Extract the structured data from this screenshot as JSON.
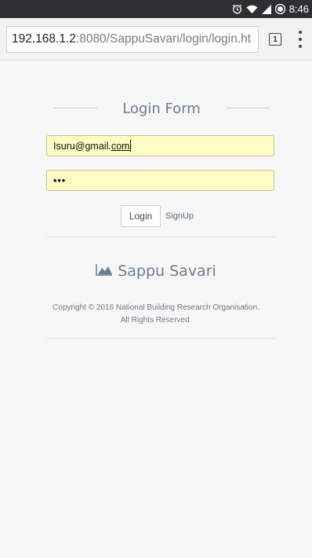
{
  "status_bar": {
    "time": "8:46",
    "alarm_icon": "alarm-icon",
    "wifi_icon": "wifi-icon",
    "signal_icon": "signal-icon",
    "battery_icon": "battery-icon"
  },
  "browser": {
    "url_host": "192.168.1.2",
    "url_path": ":8080/SappuSavari/login/login.ht",
    "tab_count": "1",
    "menu_icon": "overflow-menu-icon"
  },
  "form": {
    "title": "Login Form",
    "email_value_main": "Isuru@gmail.",
    "email_value_tail": "com",
    "password_value": "•••",
    "login_label": "Login",
    "signup_label": "SignUp"
  },
  "brand": {
    "name": "Sappu Savari",
    "logo_icon": "area-chart-icon"
  },
  "footer": {
    "copyright_line1": "Copyright © 2016 National Building Research Organisation.",
    "copyright_line2": "All Rights Reserved."
  },
  "colors": {
    "input_autofill_bg": "#fcfcc4",
    "title_color": "#6b7d90",
    "status_bar_bg": "#2f2f32"
  }
}
